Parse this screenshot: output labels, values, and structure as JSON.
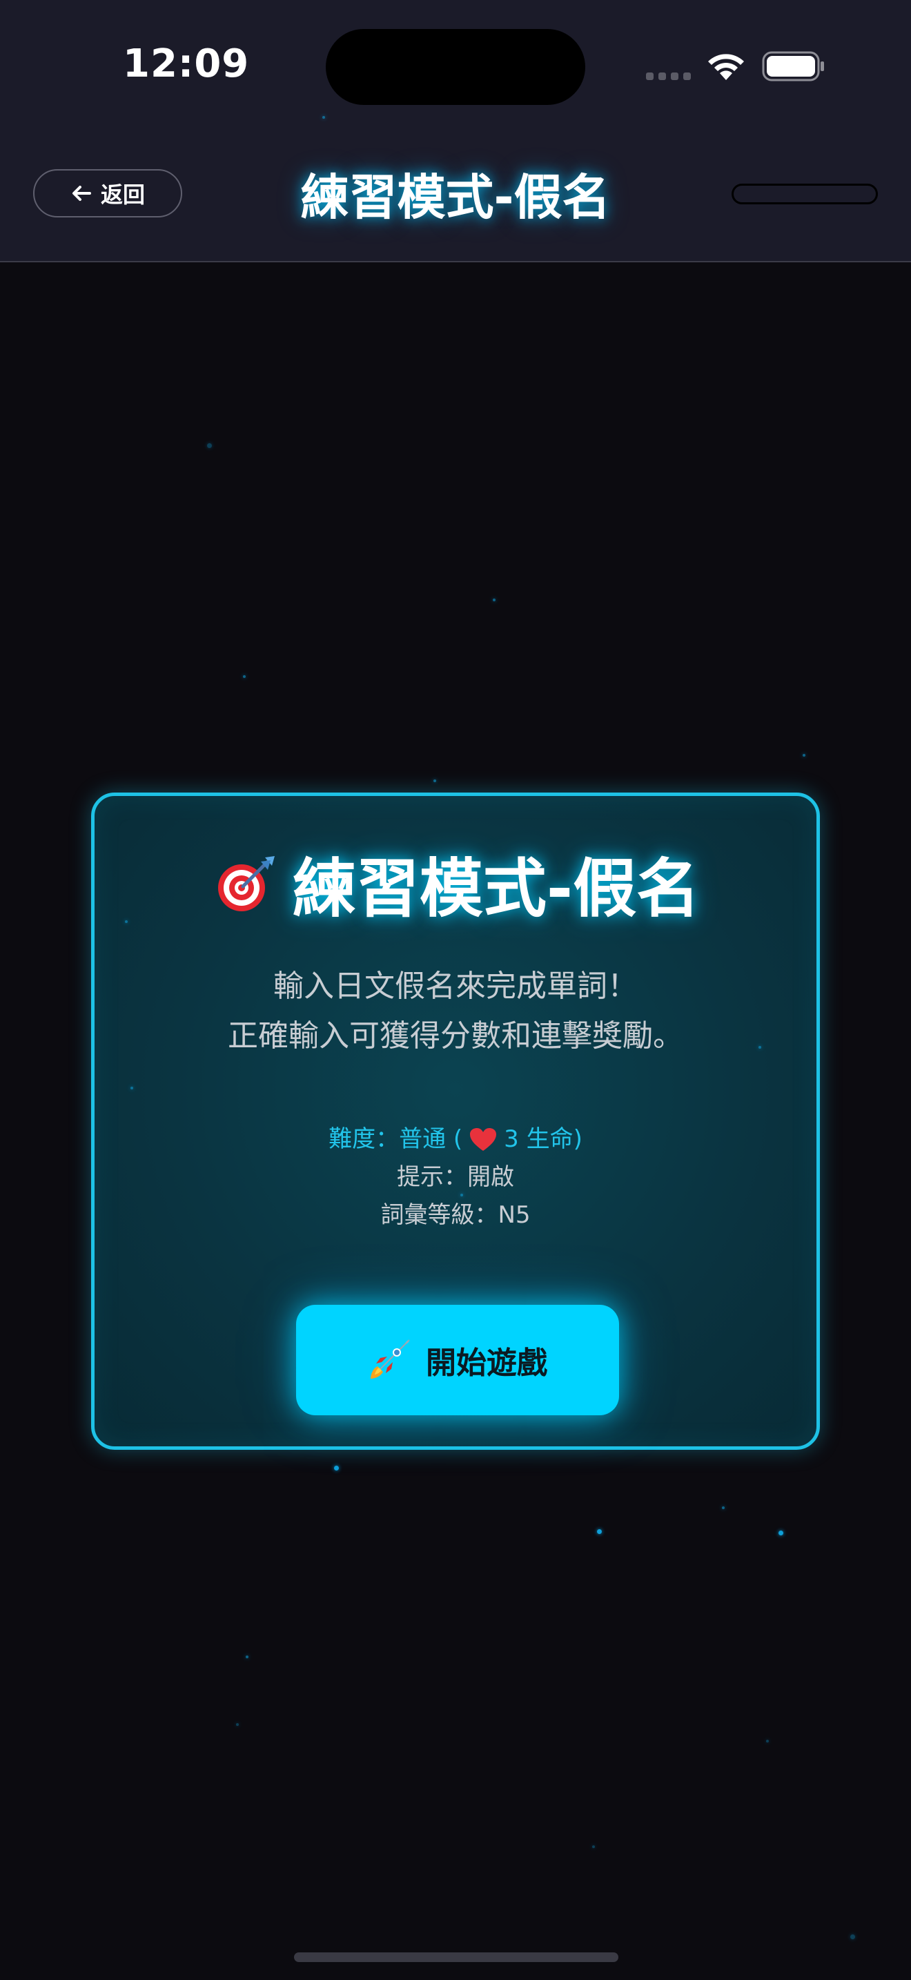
{
  "status_bar": {
    "time": "12:09"
  },
  "header": {
    "back_label": "返回",
    "title": "練習模式-假名"
  },
  "card": {
    "title": "練習模式-假名",
    "title_icon": "target-dart-icon",
    "description_lines": [
      "輸入日文假名來完成單詞！",
      "正確輸入可獲得分數和連擊獎勵。"
    ],
    "difficulty_prefix": "難度：普通 (",
    "difficulty_suffix": "3 生命)",
    "lives": 3,
    "hint": "提示：開啟",
    "level": "詞彙等級：N5",
    "start_label": "開始遊戲",
    "start_icon": "rocket-icon"
  },
  "colors": {
    "accent": "#00d4ff",
    "card_border": "#1ec2e6",
    "background": "#0c0b10",
    "header_bg": "#1b1b29",
    "difficulty_text": "#22c4ea"
  }
}
